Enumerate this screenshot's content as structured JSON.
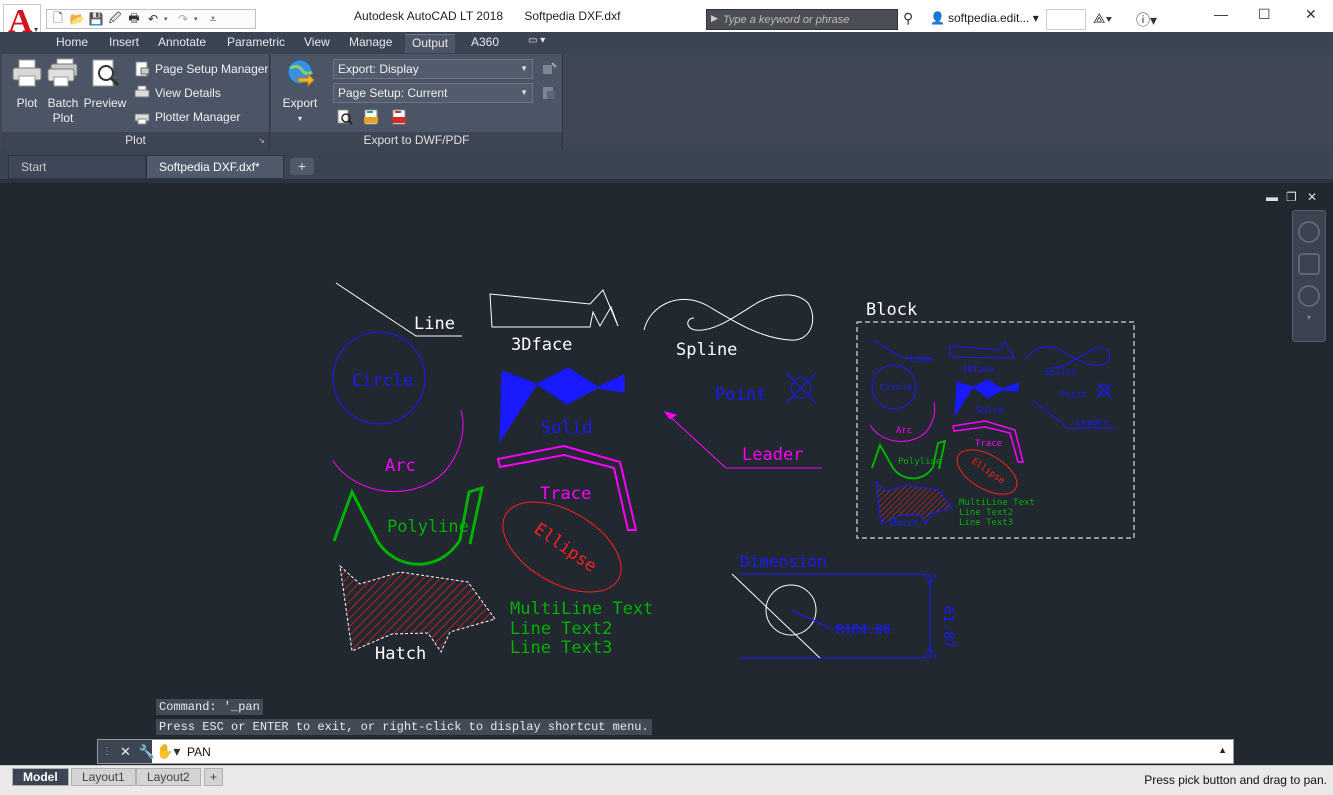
{
  "app": {
    "logo_letter": "A",
    "logo_sub": "LT",
    "title": "Autodesk AutoCAD LT 2018",
    "document": "Softpedia DXF.dxf",
    "search_placeholder": "Type a keyword or phrase",
    "user": "softpedia.edit..."
  },
  "menu_tabs": [
    "Home",
    "Insert",
    "Annotate",
    "Parametric",
    "View",
    "Manage",
    "Output",
    "A360"
  ],
  "active_tab": "Output",
  "ribbon": {
    "plot_panel": {
      "title": "Plot",
      "plot": "Plot",
      "batch_plot_1": "Batch",
      "batch_plot_2": "Plot",
      "preview": "Preview",
      "page_setup_manager": "Page Setup Manager",
      "view_details": "View Details",
      "plotter_manager": "Plotter Manager"
    },
    "export_panel": {
      "title": "Export to DWF/PDF",
      "export": "Export",
      "export_display": "Export: Display",
      "page_setup_current": "Page Setup: Current"
    }
  },
  "file_tabs": {
    "start": "Start",
    "document": "Softpedia DXF.dxf*",
    "add": "+"
  },
  "drawing": {
    "labels": {
      "line": "Line",
      "face": "3Dface",
      "spline": "Spline",
      "block": "Block",
      "circle": "Circle",
      "solid": "Solid",
      "point": "Point",
      "arc": "Arc",
      "leader": "Leader",
      "trace": "Trace",
      "polyline": "Polyline",
      "ellipse": "Ellipse",
      "dimension": "Dimension",
      "hatch": "Hatch",
      "mtext_1": "MultiLine Text",
      "mtext_2": "Line Text2",
      "mtext_3": "Line Text3",
      "dim_radius": "R184.06",
      "dim_vertical": "61.87"
    },
    "colors": {
      "white": "#ffffff",
      "blue": "#1a1aff",
      "magenta": "#ff00ff",
      "green": "#00b000",
      "red": "#ff2020"
    }
  },
  "command": {
    "history_1": "Command: '_pan",
    "history_2": "Press ESC or ENTER to exit, or right-click to display shortcut menu.",
    "current": "PAN"
  },
  "status": {
    "layout_tabs": [
      "Model",
      "Layout1",
      "Layout2"
    ],
    "add": "+",
    "message": "Press pick button and drag to pan."
  }
}
